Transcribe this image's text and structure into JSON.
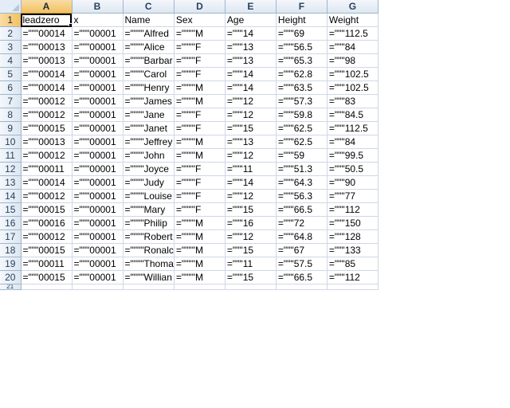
{
  "columns": [
    "A",
    "B",
    "C",
    "D",
    "E",
    "F",
    "G"
  ],
  "active_cell": "A1",
  "rows": [
    {
      "num": "1",
      "cells": [
        "leadzero",
        "x",
        "Name",
        "Sex",
        "Age",
        "Height",
        "Weight"
      ]
    },
    {
      "num": "2",
      "cells": [
        "=\"\"\"00014",
        "=\"\"\"00001",
        "=\"\"\"\"Alfred",
        "=\"\"\"\"M",
        "=\"\"\"14",
        "=\"\"\"69",
        "=\"\"\"112.5"
      ]
    },
    {
      "num": "3",
      "cells": [
        "=\"\"\"00013",
        "=\"\"\"00001",
        "=\"\"\"\"Alice",
        "=\"\"\"\"F",
        "=\"\"\"13",
        "=\"\"\"56.5",
        "=\"\"\"84"
      ]
    },
    {
      "num": "4",
      "cells": [
        "=\"\"\"00013",
        "=\"\"\"00001",
        "=\"\"\"\"Barbar",
        "=\"\"\"\"F",
        "=\"\"\"13",
        "=\"\"\"65.3",
        "=\"\"\"98"
      ]
    },
    {
      "num": "5",
      "cells": [
        "=\"\"\"00014",
        "=\"\"\"00001",
        "=\"\"\"\"Carol",
        "=\"\"\"\"F",
        "=\"\"\"14",
        "=\"\"\"62.8",
        "=\"\"\"102.5"
      ]
    },
    {
      "num": "6",
      "cells": [
        "=\"\"\"00014",
        "=\"\"\"00001",
        "=\"\"\"\"Henry",
        "=\"\"\"\"M",
        "=\"\"\"14",
        "=\"\"\"63.5",
        "=\"\"\"102.5"
      ]
    },
    {
      "num": "7",
      "cells": [
        "=\"\"\"00012",
        "=\"\"\"00001",
        "=\"\"\"\"James",
        "=\"\"\"\"M",
        "=\"\"\"12",
        "=\"\"\"57.3",
        "=\"\"\"83"
      ]
    },
    {
      "num": "8",
      "cells": [
        "=\"\"\"00012",
        "=\"\"\"00001",
        "=\"\"\"\"Jane",
        "=\"\"\"\"F",
        "=\"\"\"12",
        "=\"\"\"59.8",
        "=\"\"\"84.5"
      ]
    },
    {
      "num": "9",
      "cells": [
        "=\"\"\"00015",
        "=\"\"\"00001",
        "=\"\"\"\"Janet",
        "=\"\"\"\"F",
        "=\"\"\"15",
        "=\"\"\"62.5",
        "=\"\"\"112.5"
      ]
    },
    {
      "num": "10",
      "cells": [
        "=\"\"\"00013",
        "=\"\"\"00001",
        "=\"\"\"\"Jeffrey",
        "=\"\"\"\"M",
        "=\"\"\"13",
        "=\"\"\"62.5",
        "=\"\"\"84"
      ]
    },
    {
      "num": "11",
      "cells": [
        "=\"\"\"00012",
        "=\"\"\"00001",
        "=\"\"\"\"John",
        "=\"\"\"\"M",
        "=\"\"\"12",
        "=\"\"\"59",
        "=\"\"\"99.5"
      ]
    },
    {
      "num": "12",
      "cells": [
        "=\"\"\"00011",
        "=\"\"\"00001",
        "=\"\"\"\"Joyce",
        "=\"\"\"\"F",
        "=\"\"\"11",
        "=\"\"\"51.3",
        "=\"\"\"50.5"
      ]
    },
    {
      "num": "13",
      "cells": [
        "=\"\"\"00014",
        "=\"\"\"00001",
        "=\"\"\"\"Judy",
        "=\"\"\"\"F",
        "=\"\"\"14",
        "=\"\"\"64.3",
        "=\"\"\"90"
      ]
    },
    {
      "num": "14",
      "cells": [
        "=\"\"\"00012",
        "=\"\"\"00001",
        "=\"\"\"\"Louise",
        "=\"\"\"\"F",
        "=\"\"\"12",
        "=\"\"\"56.3",
        "=\"\"\"77"
      ]
    },
    {
      "num": "15",
      "cells": [
        "=\"\"\"00015",
        "=\"\"\"00001",
        "=\"\"\"\"Mary",
        "=\"\"\"\"F",
        "=\"\"\"15",
        "=\"\"\"66.5",
        "=\"\"\"112"
      ]
    },
    {
      "num": "16",
      "cells": [
        "=\"\"\"00016",
        "=\"\"\"00001",
        "=\"\"\"\"Philip",
        "=\"\"\"\"M",
        "=\"\"\"16",
        "=\"\"\"72",
        "=\"\"\"150"
      ]
    },
    {
      "num": "17",
      "cells": [
        "=\"\"\"00012",
        "=\"\"\"00001",
        "=\"\"\"\"Robert",
        "=\"\"\"\"M",
        "=\"\"\"12",
        "=\"\"\"64.8",
        "=\"\"\"128"
      ]
    },
    {
      "num": "18",
      "cells": [
        "=\"\"\"00015",
        "=\"\"\"00001",
        "=\"\"\"\"Ronalc",
        "=\"\"\"\"M",
        "=\"\"\"15",
        "=\"\"\"67",
        "=\"\"\"133"
      ]
    },
    {
      "num": "19",
      "cells": [
        "=\"\"\"00011",
        "=\"\"\"00001",
        "=\"\"\"\"Thoma",
        "=\"\"\"\"M",
        "=\"\"\"11",
        "=\"\"\"57.5",
        "=\"\"\"85"
      ]
    },
    {
      "num": "20",
      "cells": [
        "=\"\"\"00015",
        "=\"\"\"00001",
        "=\"\"\"\"Willian",
        "=\"\"\"\"M",
        "=\"\"\"15",
        "=\"\"\"66.5",
        "=\"\"\"112"
      ]
    }
  ],
  "partial_row": {
    "num": "21"
  },
  "colors": {
    "header_bg": "#dde6f1",
    "active_header_bg": "#f1c15f",
    "gridline": "#d0d7e5"
  },
  "icons": {
    "select_all": "select-all-triangle-icon"
  }
}
